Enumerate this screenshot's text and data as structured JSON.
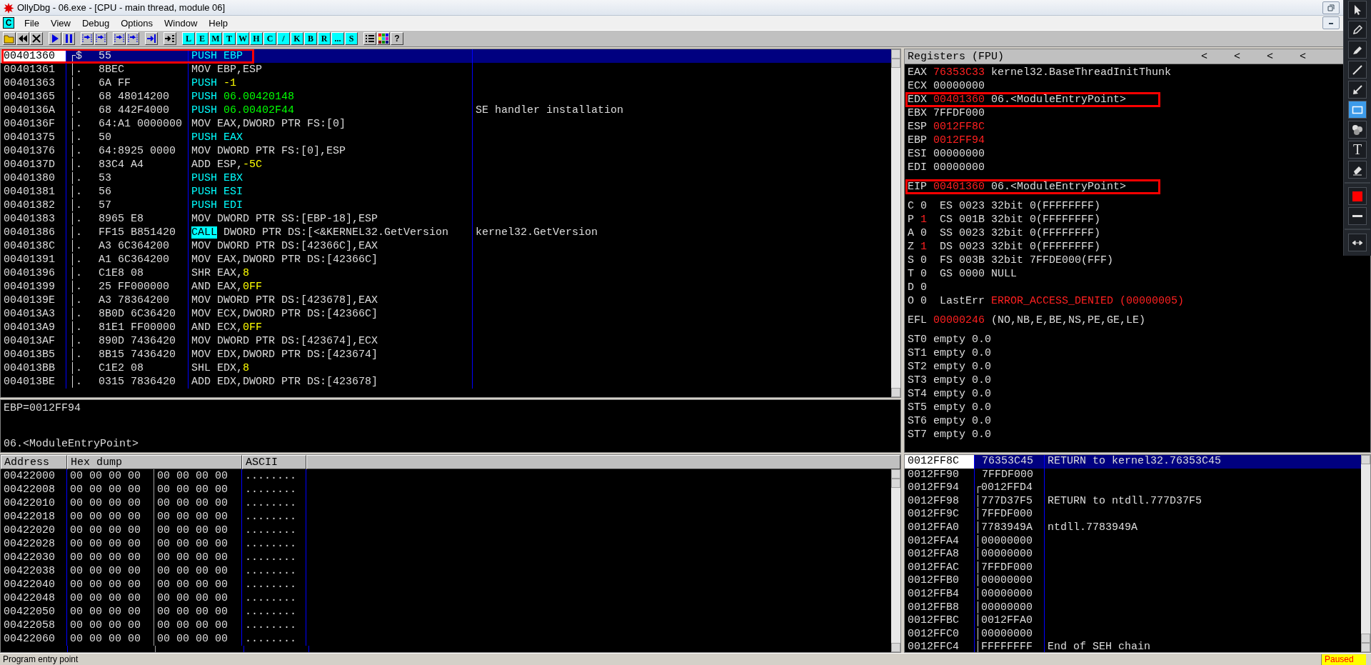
{
  "window": {
    "title": "OllyDbg - 06.exe - [CPU - main thread, module 06]"
  },
  "menu": {
    "child_icon": "C",
    "items": [
      "File",
      "View",
      "Debug",
      "Options",
      "Window",
      "Help"
    ]
  },
  "toolbar": {
    "groups": [
      [
        {
          "kind": "open"
        },
        {
          "kind": "rewind"
        },
        {
          "kind": "close"
        }
      ],
      [
        {
          "kind": "play"
        },
        {
          "kind": "pause"
        }
      ],
      [
        {
          "kind": "step"
        },
        {
          "kind": "step"
        }
      ],
      [
        {
          "kind": "step"
        },
        {
          "kind": "step"
        }
      ],
      [
        {
          "kind": "return"
        }
      ],
      [
        {
          "kind": "goto"
        }
      ],
      [
        {
          "kind": "letter",
          "label": "L"
        },
        {
          "kind": "letter",
          "label": "E"
        },
        {
          "kind": "letter",
          "label": "M"
        },
        {
          "kind": "letter",
          "label": "T"
        },
        {
          "kind": "letter",
          "label": "W"
        },
        {
          "kind": "letter",
          "label": "H"
        },
        {
          "kind": "letter",
          "label": "C"
        },
        {
          "kind": "letter",
          "label": "/"
        },
        {
          "kind": "letter",
          "label": "K"
        },
        {
          "kind": "letter",
          "label": "B"
        },
        {
          "kind": "letter",
          "label": "R"
        },
        {
          "kind": "letter",
          "label": "..."
        },
        {
          "kind": "letter",
          "label": "S"
        }
      ],
      [
        {
          "kind": "list"
        },
        {
          "kind": "grid"
        },
        {
          "kind": "help",
          "label": "?"
        }
      ]
    ]
  },
  "disasm": {
    "rows": [
      {
        "address": "00401360",
        "marker": "┌$",
        "hex": "55",
        "command": [
          {
            "text": "PUSH EBP",
            "kind": "stack"
          }
        ],
        "selected": true,
        "boxed": true
      },
      {
        "address": "00401361",
        "marker": "│.",
        "hex": "8BEC",
        "command": [
          {
            "text": "MOV EBP,ESP",
            "kind": "plain"
          }
        ],
        "selected": false,
        "boxed": false
      },
      {
        "address": "00401363",
        "marker": "│.",
        "hex": "6A FF",
        "command": [
          {
            "text": "PUSH ",
            "kind": "stack"
          },
          {
            "text": "-1",
            "kind": "const"
          }
        ],
        "selected": false,
        "boxed": false
      },
      {
        "address": "00401365",
        "marker": "│.",
        "hex": "68 48014200",
        "command": [
          {
            "text": "PUSH ",
            "kind": "stack"
          },
          {
            "text": "06.00420148",
            "kind": "addr"
          }
        ],
        "selected": false,
        "boxed": false
      },
      {
        "address": "0040136A",
        "marker": "│.",
        "hex": "68 442F4000",
        "command": [
          {
            "text": "PUSH ",
            "kind": "stack"
          },
          {
            "text": "06.00402F44",
            "kind": "addr"
          }
        ],
        "comment": "SE handler installation",
        "selected": false,
        "boxed": false
      },
      {
        "address": "0040136F",
        "marker": "│.",
        "hex": "64:A1 0000000",
        "command": [
          {
            "text": "MOV EAX,DWORD PTR FS:[0]",
            "kind": "plain"
          }
        ],
        "selected": false,
        "boxed": false
      },
      {
        "address": "00401375",
        "marker": "│.",
        "hex": "50",
        "command": [
          {
            "text": "PUSH EAX",
            "kind": "stack"
          }
        ],
        "selected": false,
        "boxed": false
      },
      {
        "address": "00401376",
        "marker": "│.",
        "hex": "64:8925 0000",
        "command": [
          {
            "text": "MOV DWORD PTR FS:[0],ESP",
            "kind": "plain"
          }
        ],
        "selected": false,
        "boxed": false
      },
      {
        "address": "0040137D",
        "marker": "│.",
        "hex": "83C4 A4",
        "command": [
          {
            "text": "ADD ESP,",
            "kind": "plain"
          },
          {
            "text": "-5C",
            "kind": "const"
          }
        ],
        "selected": false,
        "boxed": false
      },
      {
        "address": "00401380",
        "marker": "│.",
        "hex": "53",
        "command": [
          {
            "text": "PUSH EBX",
            "kind": "stack"
          }
        ],
        "selected": false,
        "boxed": false
      },
      {
        "address": "00401381",
        "marker": "│.",
        "hex": "56",
        "command": [
          {
            "text": "PUSH ESI",
            "kind": "stack"
          }
        ],
        "selected": false,
        "boxed": false
      },
      {
        "address": "00401382",
        "marker": "│.",
        "hex": "57",
        "command": [
          {
            "text": "PUSH EDI",
            "kind": "stack"
          }
        ],
        "selected": false,
        "boxed": false
      },
      {
        "address": "00401383",
        "marker": "│.",
        "hex": "8965 E8",
        "command": [
          {
            "text": "MOV DWORD PTR SS:[EBP-18],ESP",
            "kind": "plain"
          }
        ],
        "selected": false,
        "boxed": false
      },
      {
        "address": "00401386",
        "marker": "│.",
        "hex": "FF15 B851420",
        "command": [
          {
            "text": "CALL",
            "kind": "call"
          },
          {
            "text": " DWORD PTR DS:[<&KERNEL32.GetVersion",
            "kind": "plain"
          }
        ],
        "comment": "kernel32.GetVersion",
        "selected": false,
        "boxed": false
      },
      {
        "address": "0040138C",
        "marker": "│.",
        "hex": "A3 6C364200",
        "command": [
          {
            "text": "MOV DWORD PTR DS:[42366C],EAX",
            "kind": "plain"
          }
        ],
        "selected": false,
        "boxed": false
      },
      {
        "address": "00401391",
        "marker": "│.",
        "hex": "A1 6C364200",
        "command": [
          {
            "text": "MOV EAX,DWORD PTR DS:[42366C]",
            "kind": "plain"
          }
        ],
        "selected": false,
        "boxed": false
      },
      {
        "address": "00401396",
        "marker": "│.",
        "hex": "C1E8 08",
        "command": [
          {
            "text": "SHR EAX,",
            "kind": "plain"
          },
          {
            "text": "8",
            "kind": "const"
          }
        ],
        "selected": false,
        "boxed": false
      },
      {
        "address": "00401399",
        "marker": "│.",
        "hex": "25 FF000000",
        "command": [
          {
            "text": "AND EAX,",
            "kind": "plain"
          },
          {
            "text": "0FF",
            "kind": "const"
          }
        ],
        "selected": false,
        "boxed": false
      },
      {
        "address": "0040139E",
        "marker": "│.",
        "hex": "A3 78364200",
        "command": [
          {
            "text": "MOV DWORD PTR DS:[423678],EAX",
            "kind": "plain"
          }
        ],
        "selected": false,
        "boxed": false
      },
      {
        "address": "004013A3",
        "marker": "│.",
        "hex": "8B0D 6C36420",
        "command": [
          {
            "text": "MOV ECX,DWORD PTR DS:[42366C]",
            "kind": "plain"
          }
        ],
        "selected": false,
        "boxed": false
      },
      {
        "address": "004013A9",
        "marker": "│.",
        "hex": "81E1 FF00000",
        "command": [
          {
            "text": "AND ECX,",
            "kind": "plain"
          },
          {
            "text": "0FF",
            "kind": "const"
          }
        ],
        "selected": false,
        "boxed": false
      },
      {
        "address": "004013AF",
        "marker": "│.",
        "hex": "890D 7436420",
        "command": [
          {
            "text": "MOV DWORD PTR DS:[423674],ECX",
            "kind": "plain"
          }
        ],
        "selected": false,
        "boxed": false
      },
      {
        "address": "004013B5",
        "marker": "│.",
        "hex": "8B15 7436420",
        "command": [
          {
            "text": "MOV EDX,DWORD PTR DS:[423674]",
            "kind": "plain"
          }
        ],
        "selected": false,
        "boxed": false
      },
      {
        "address": "004013BB",
        "marker": "│.",
        "hex": "C1E2 08",
        "command": [
          {
            "text": "SHL EDX,",
            "kind": "plain"
          },
          {
            "text": "8",
            "kind": "const"
          }
        ],
        "selected": false,
        "boxed": false
      },
      {
        "address": "004013BE",
        "marker": "│.",
        "hex": "0315 7836420",
        "command": [
          {
            "text": "ADD EDX,DWORD PTR DS:[423678]",
            "kind": "plain"
          }
        ],
        "selected": false,
        "boxed": false
      }
    ]
  },
  "info": {
    "lines": [
      "EBP=0012FF94",
      "06.<ModuleEntryPoint>"
    ]
  },
  "registers": {
    "title": "Registers (FPU)",
    "arrows": [
      "<",
      "<",
      "<",
      "<"
    ],
    "sections": [
      [
        {
          "kind": "reg",
          "name": "EAX",
          "value": "76353C33",
          "changed": true,
          "comment": "kernel32.BaseThreadInitThunk",
          "boxed": false
        },
        {
          "kind": "reg",
          "name": "ECX",
          "value": "00000000",
          "changed": false,
          "boxed": false
        },
        {
          "kind": "reg",
          "name": "EDX",
          "value": "00401360",
          "changed": true,
          "comment": "06.<ModuleEntryPoint>",
          "boxed": true
        },
        {
          "kind": "reg",
          "name": "EBX",
          "value": "7FFDF000",
          "changed": false,
          "boxed": false
        },
        {
          "kind": "reg",
          "name": "ESP",
          "value": "0012FF8C",
          "changed": true,
          "boxed": false
        },
        {
          "kind": "reg",
          "name": "EBP",
          "value": "0012FF94",
          "changed": true,
          "boxed": false
        },
        {
          "kind": "reg",
          "name": "ESI",
          "value": "00000000",
          "changed": false,
          "boxed": false
        },
        {
          "kind": "reg",
          "name": "EDI",
          "value": "00000000",
          "changed": false,
          "boxed": false
        }
      ],
      [
        {
          "kind": "reg",
          "name": "EIP",
          "value": "00401360",
          "changed": true,
          "comment": "06.<ModuleEntryPoint>",
          "boxed": true
        }
      ],
      [
        {
          "kind": "flag",
          "name": "C",
          "value": "0",
          "changed": false,
          "segment": "ES 0023 32bit 0(FFFFFFFF)"
        },
        {
          "kind": "flag",
          "name": "P",
          "value": "1",
          "changed": true,
          "segment": "CS 001B 32bit 0(FFFFFFFF)"
        },
        {
          "kind": "flag",
          "name": "A",
          "value": "0",
          "changed": false,
          "segment": "SS 0023 32bit 0(FFFFFFFF)"
        },
        {
          "kind": "flag",
          "name": "Z",
          "value": "1",
          "changed": true,
          "segment": "DS 0023 32bit 0(FFFFFFFF)"
        },
        {
          "kind": "flag",
          "name": "S",
          "value": "0",
          "changed": false,
          "segment": "FS 003B 32bit 7FFDE000(FFF)"
        },
        {
          "kind": "flag",
          "name": "T",
          "value": "0",
          "changed": false,
          "segment": "GS 0000 NULL"
        },
        {
          "kind": "flag",
          "name": "D",
          "value": "0",
          "changed": false
        },
        {
          "kind": "flag",
          "name": "O",
          "value": "0",
          "changed": false,
          "label": "LastErr",
          "error": "ERROR_ACCESS_DENIED (00000005)"
        }
      ],
      [
        {
          "kind": "reg",
          "name": "EFL",
          "value": "00000246",
          "changed": true,
          "comment": "(NO,NB,E,BE,NS,PE,GE,LE)",
          "boxed": false
        }
      ],
      [
        {
          "kind": "fpu",
          "name": "ST0",
          "value": "empty 0.0"
        },
        {
          "kind": "fpu",
          "name": "ST1",
          "value": "empty 0.0"
        },
        {
          "kind": "fpu",
          "name": "ST2",
          "value": "empty 0.0"
        },
        {
          "kind": "fpu",
          "name": "ST3",
          "value": "empty 0.0"
        },
        {
          "kind": "fpu",
          "name": "ST4",
          "value": "empty 0.0"
        },
        {
          "kind": "fpu",
          "name": "ST5",
          "value": "empty 0.0"
        },
        {
          "kind": "fpu",
          "name": "ST6",
          "value": "empty 0.0"
        },
        {
          "kind": "fpu",
          "name": "ST7",
          "value": "empty 0.0"
        }
      ]
    ]
  },
  "dump": {
    "columns": [
      "Address",
      "Hex dump",
      "ASCII"
    ],
    "rows": [
      {
        "address": "00422000",
        "hex": [
          "00 00 00 00",
          "00 00 00 00"
        ],
        "ascii": "........"
      },
      {
        "address": "00422008",
        "hex": [
          "00 00 00 00",
          "00 00 00 00"
        ],
        "ascii": "........"
      },
      {
        "address": "00422010",
        "hex": [
          "00 00 00 00",
          "00 00 00 00"
        ],
        "ascii": "........"
      },
      {
        "address": "00422018",
        "hex": [
          "00 00 00 00",
          "00 00 00 00"
        ],
        "ascii": "........"
      },
      {
        "address": "00422020",
        "hex": [
          "00 00 00 00",
          "00 00 00 00"
        ],
        "ascii": "........"
      },
      {
        "address": "00422028",
        "hex": [
          "00 00 00 00",
          "00 00 00 00"
        ],
        "ascii": "........"
      },
      {
        "address": "00422030",
        "hex": [
          "00 00 00 00",
          "00 00 00 00"
        ],
        "ascii": "........"
      },
      {
        "address": "00422038",
        "hex": [
          "00 00 00 00",
          "00 00 00 00"
        ],
        "ascii": "........"
      },
      {
        "address": "00422040",
        "hex": [
          "00 00 00 00",
          "00 00 00 00"
        ],
        "ascii": "........"
      },
      {
        "address": "00422048",
        "hex": [
          "00 00 00 00",
          "00 00 00 00"
        ],
        "ascii": "........"
      },
      {
        "address": "00422050",
        "hex": [
          "00 00 00 00",
          "00 00 00 00"
        ],
        "ascii": "........"
      },
      {
        "address": "00422058",
        "hex": [
          "00 00 00 00",
          "00 00 00 00"
        ],
        "ascii": "........"
      },
      {
        "address": "00422060",
        "hex": [
          "00 00 00 00",
          "00 00 00 00"
        ],
        "ascii": "........"
      }
    ]
  },
  "stack": {
    "rows": [
      {
        "address": "0012FF8C",
        "value": "76353C45",
        "comment": "RETURN to kernel32.76353C45",
        "selected": true
      },
      {
        "address": "0012FF90",
        "value": "7FFDF000",
        "selected": false
      },
      {
        "address": "0012FF94",
        "bracket": "┌",
        "value": "0012FFD4",
        "selected": false
      },
      {
        "address": "0012FF98",
        "bracket": "│",
        "value": "777D37F5",
        "comment": "RETURN to ntdll.777D37F5",
        "selected": false
      },
      {
        "address": "0012FF9C",
        "bracket": "│",
        "value": "7FFDF000",
        "selected": false
      },
      {
        "address": "0012FFA0",
        "bracket": "│",
        "value": "7783949A",
        "comment": "ntdll.7783949A",
        "selected": false
      },
      {
        "address": "0012FFA4",
        "bracket": "│",
        "value": "00000000",
        "selected": false
      },
      {
        "address": "0012FFA8",
        "bracket": "│",
        "value": "00000000",
        "selected": false
      },
      {
        "address": "0012FFAC",
        "bracket": "│",
        "value": "7FFDF000",
        "selected": false
      },
      {
        "address": "0012FFB0",
        "bracket": "│",
        "value": "00000000",
        "selected": false
      },
      {
        "address": "0012FFB4",
        "bracket": "│",
        "value": "00000000",
        "selected": false
      },
      {
        "address": "0012FFB8",
        "bracket": "│",
        "value": "00000000",
        "selected": false
      },
      {
        "address": "0012FFBC",
        "bracket": "│",
        "value": "0012FFA0",
        "selected": false
      },
      {
        "address": "0012FFC0",
        "bracket": "│",
        "value": "00000000",
        "selected": false
      },
      {
        "address": "0012FFC4",
        "bracket": "│",
        "value": "FFFFFFFF",
        "comment": "End of SEH chain",
        "selected": false
      }
    ]
  },
  "status_bar": {
    "message": "Program entry point",
    "state": "Paused"
  },
  "annotation_tools": {
    "tools": [
      {
        "kind": "select",
        "selected": false
      },
      {
        "kind": "pencil",
        "selected": false
      },
      {
        "kind": "marker",
        "selected": false
      },
      {
        "kind": "line",
        "selected": false
      },
      {
        "kind": "arrow",
        "selected": false
      },
      {
        "kind": "rectangle",
        "selected": true
      },
      {
        "kind": "numbers",
        "selected": false
      },
      {
        "kind": "text",
        "label": "T",
        "selected": false
      },
      {
        "kind": "eraser",
        "selected": false
      }
    ],
    "color": "#ff0000"
  }
}
